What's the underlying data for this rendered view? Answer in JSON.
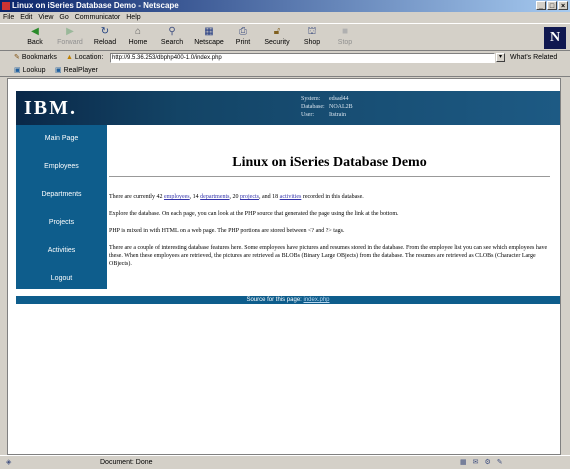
{
  "window": {
    "title": "Linux on iSeries Database Demo - Netscape"
  },
  "menu": [
    "File",
    "Edit",
    "View",
    "Go",
    "Communicator",
    "Help"
  ],
  "toolbar": {
    "back": "Back",
    "forward": "Forward",
    "reload": "Reload",
    "home": "Home",
    "search": "Search",
    "netscape": "Netscape",
    "print": "Print",
    "security": "Security",
    "shop": "Shop",
    "stop": "Stop"
  },
  "location": {
    "bookmarks_label": "Bookmarks",
    "location_label": "Location:",
    "url": "http://9.5.36.253/dbphp400-1.0/index.php",
    "whats_related": "What's Related"
  },
  "personal_toolbar": {
    "lookup": "Lookup",
    "realplayer": "RealPlayer"
  },
  "header": {
    "logo": "IBM.",
    "system_label": "System:",
    "system_value": "edsad44",
    "database_label": "Database:",
    "database_value": "NOAL2B",
    "user_label": "User:",
    "user_value": "Itstrain"
  },
  "sidebar": {
    "items": [
      {
        "label": "Main Page"
      },
      {
        "label": "Employees"
      },
      {
        "label": "Departments"
      },
      {
        "label": "Projects"
      },
      {
        "label": "Activities"
      },
      {
        "label": "Logout"
      }
    ]
  },
  "main": {
    "title": "Linux on iSeries Database Demo",
    "p1": {
      "before": "There are currently 42 ",
      "link1": "employees",
      "mid1": ", 14 ",
      "link2": "departments",
      "mid2": ", 20 ",
      "link3": "projects",
      "mid3": ", and 18 ",
      "link4": "activities",
      "after": " recorded in this database."
    },
    "p2": "Explore the database. On each page, you can look at the PHP source that generated the page using the link at the bottom.",
    "p3": "PHP is mixed in with HTML on a web page. The PHP portions are stored between <? and ?> tags.",
    "p4": "There are a couple of interesting database features here. Some employees have pictures and resumes stored in the database. From the employee list you can see which employees have these. When these employees are retrieved, the pictures are retrieved as BLOBs (Binary Large OBjects) from the database. The resumes are retrieved as CLOBs (Character Large OBjects)."
  },
  "footer": {
    "label": "Source for this page:",
    "link": "index.php"
  },
  "status": {
    "text": "Document: Done"
  }
}
